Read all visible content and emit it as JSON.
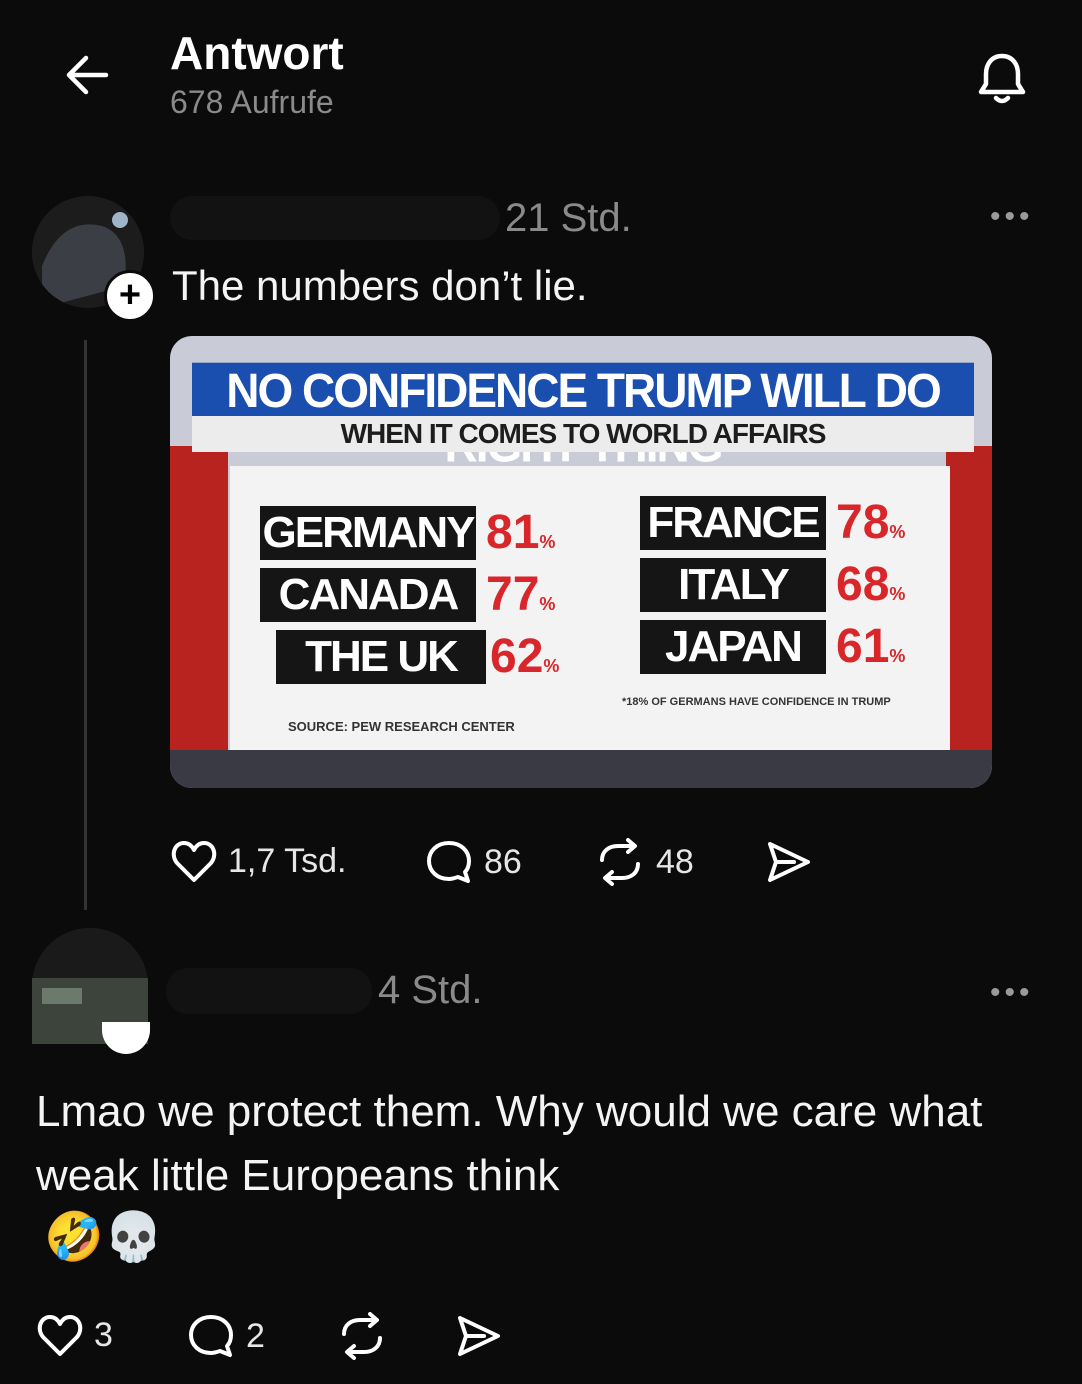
{
  "header": {
    "title": "Antwort",
    "views": "678 Aufrufe"
  },
  "post1": {
    "time": "21 Std.",
    "text": "The numbers don’t lie.",
    "image": {
      "headline": "NO CONFIDENCE TRUMP WILL DO RIGHT THING",
      "subheadline": "WHEN IT COMES TO WORLD AFFAIRS",
      "countries": [
        {
          "name": "GERMANY",
          "value": "81"
        },
        {
          "name": "CANADA",
          "value": "77"
        },
        {
          "name": "THE UK",
          "value": "62"
        },
        {
          "name": "FRANCE",
          "value": "78"
        },
        {
          "name": "ITALY",
          "value": "68"
        },
        {
          "name": "JAPAN",
          "value": "61"
        }
      ],
      "source": "SOURCE: PEW RESEARCH CENTER",
      "note": "*18% OF GERMANS HAVE CONFIDENCE IN TRUMP"
    },
    "actions": {
      "likes": "1,7 Tsd.",
      "replies": "86",
      "reposts": "48"
    }
  },
  "post2": {
    "time": "4 Std.",
    "text": "Lmao we protect them. Why would we care what weak little Europeans think",
    "emoji": "🤣💀",
    "actions": {
      "likes": "3",
      "replies": "2"
    }
  },
  "icons": [
    "back-arrow-icon",
    "bell-icon",
    "more-icon",
    "heart-icon",
    "comment-icon",
    "repost-icon",
    "share-icon",
    "plus-icon"
  ]
}
